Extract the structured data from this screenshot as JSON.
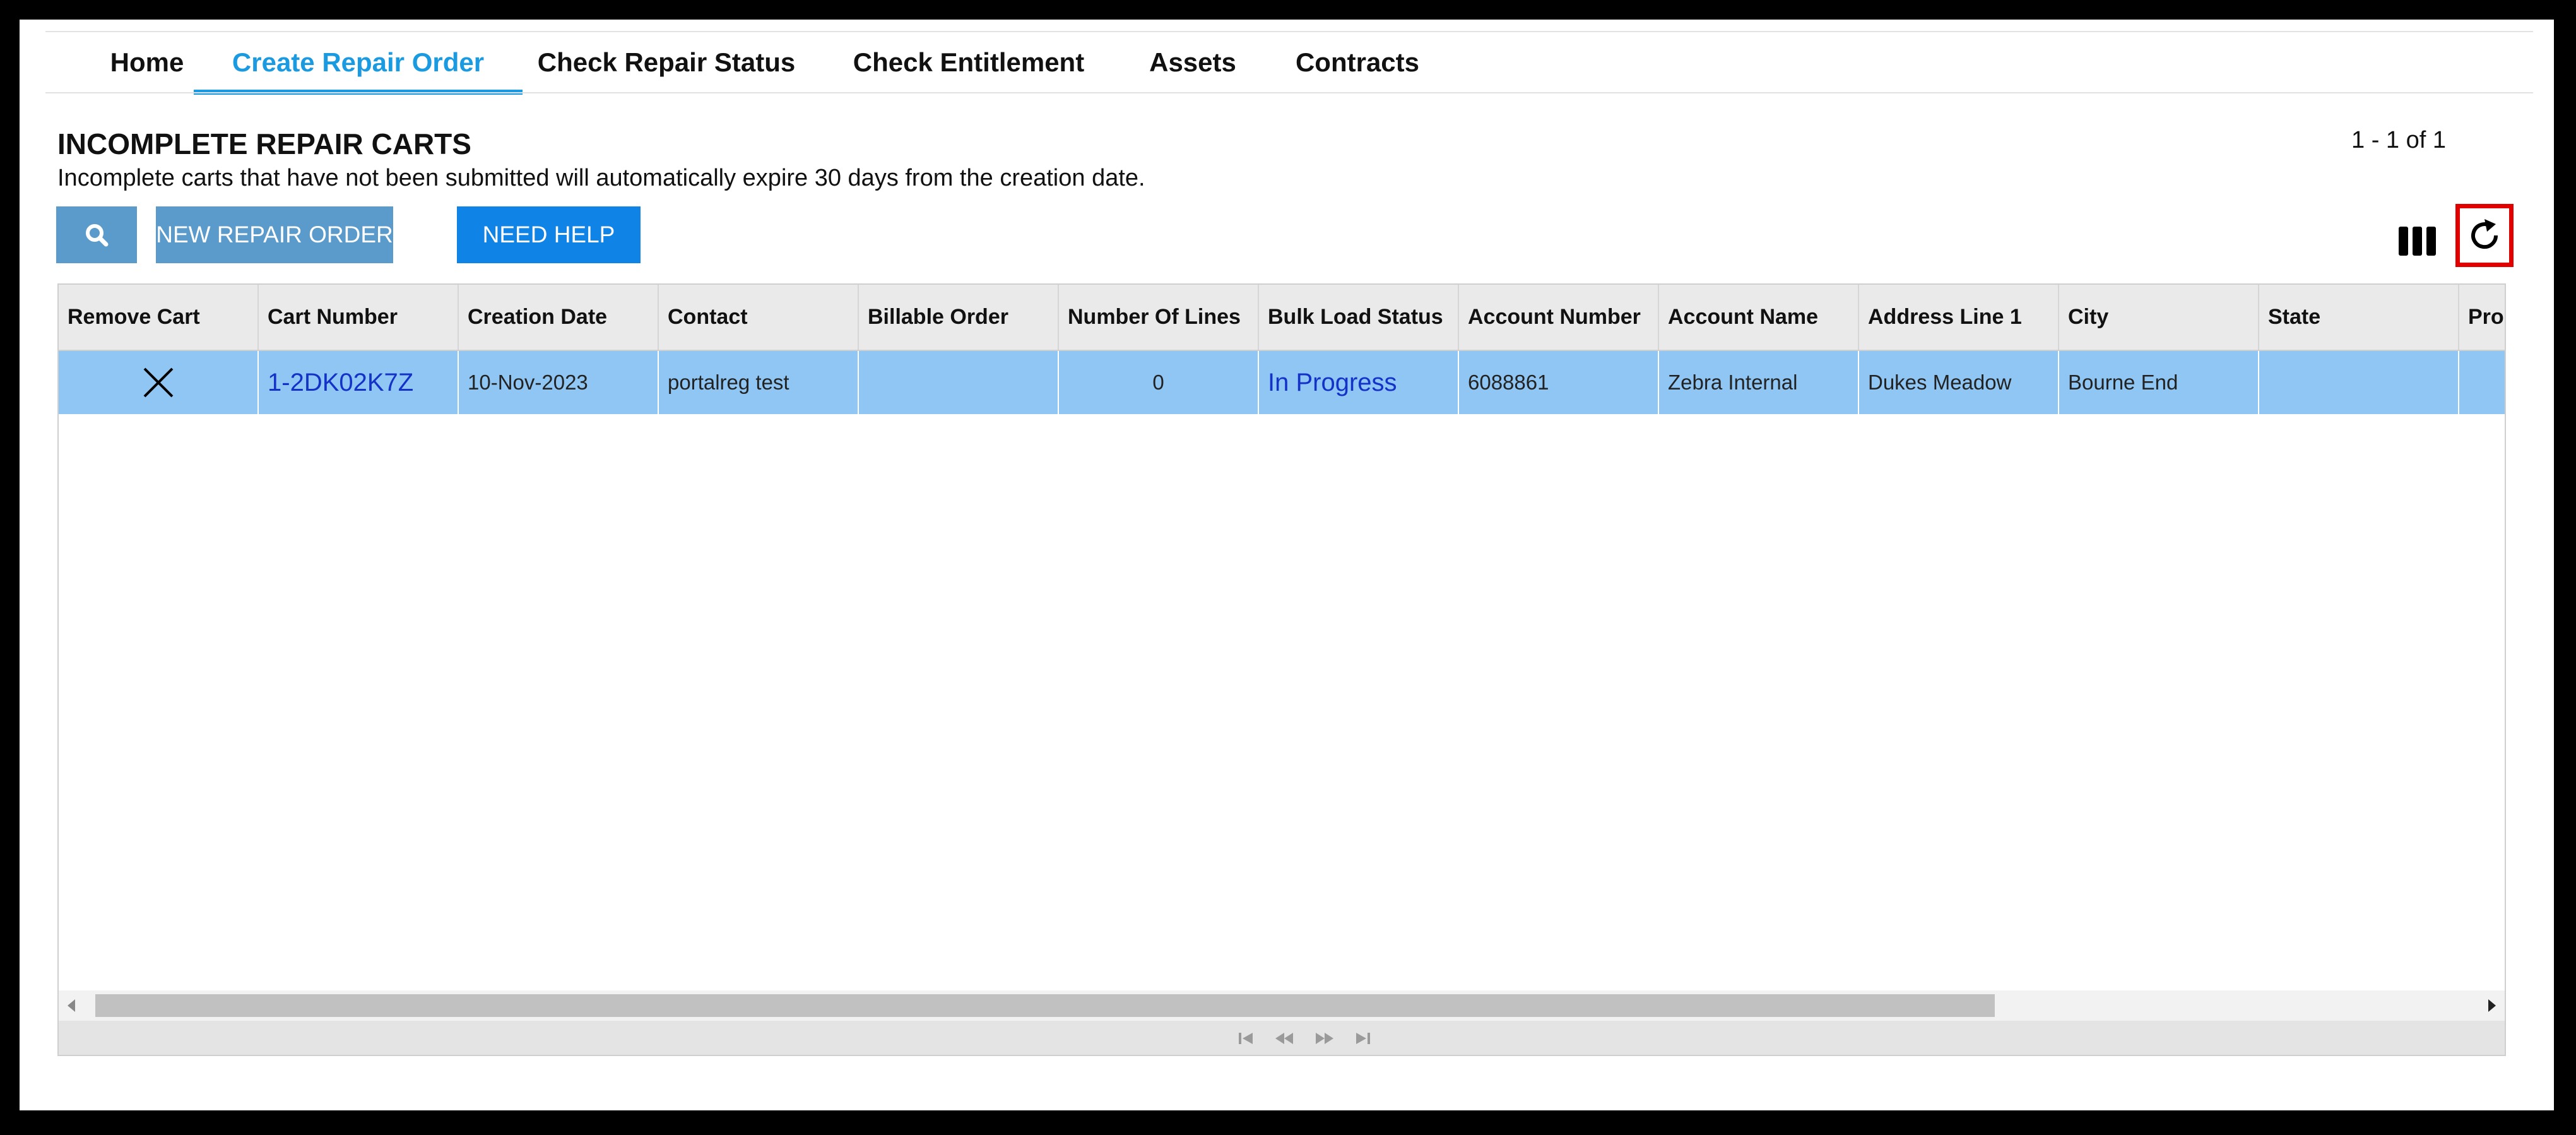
{
  "nav": {
    "tabs": [
      {
        "label": "Home",
        "active": false
      },
      {
        "label": "Create Repair Order",
        "active": true
      },
      {
        "label": "Check Repair Status",
        "active": false
      },
      {
        "label": "Check Entitlement",
        "active": false
      },
      {
        "label": "Assets",
        "active": false
      },
      {
        "label": "Contracts",
        "active": false
      }
    ]
  },
  "header": {
    "title": "INCOMPLETE REPAIR CARTS",
    "subtitle": "Incomplete carts that have not been submitted will automatically expire 30 days from the creation date.",
    "record_range": "1 - 1 of 1"
  },
  "toolbar": {
    "search_icon": "search-icon",
    "new_label": "NEW REPAIR ORDER",
    "help_label": "NEED HELP",
    "columns_icon": "columns-icon",
    "refresh_icon": "refresh-icon"
  },
  "table": {
    "columns": [
      "Remove Cart",
      "Cart Number",
      "Creation Date",
      "Contact",
      "Billable Order",
      "Number Of Lines",
      "Bulk Load Status",
      "Account Number",
      "Account Name",
      "Address Line 1",
      "City",
      "State",
      "Pro"
    ],
    "rows": [
      {
        "remove_icon": "close-icon",
        "cart_number": "1-2DK02K7Z",
        "creation_date": "10-Nov-2023",
        "contact": "portalreg test",
        "billable_order": "",
        "number_of_lines": "0",
        "bulk_load_status": "In Progress",
        "account_number": "6088861",
        "account_name": "Zebra Internal",
        "address_line_1": "Dukes Meadow",
        "city": "Bourne End",
        "state": "",
        "province": ""
      }
    ]
  },
  "colors": {
    "accent": "#1a9ae0",
    "button_light": "#5a9bcb",
    "button_primary": "#1083e6",
    "row_selected": "#8fc6f3",
    "link": "#1432c8",
    "highlight_box": "#e00000"
  }
}
